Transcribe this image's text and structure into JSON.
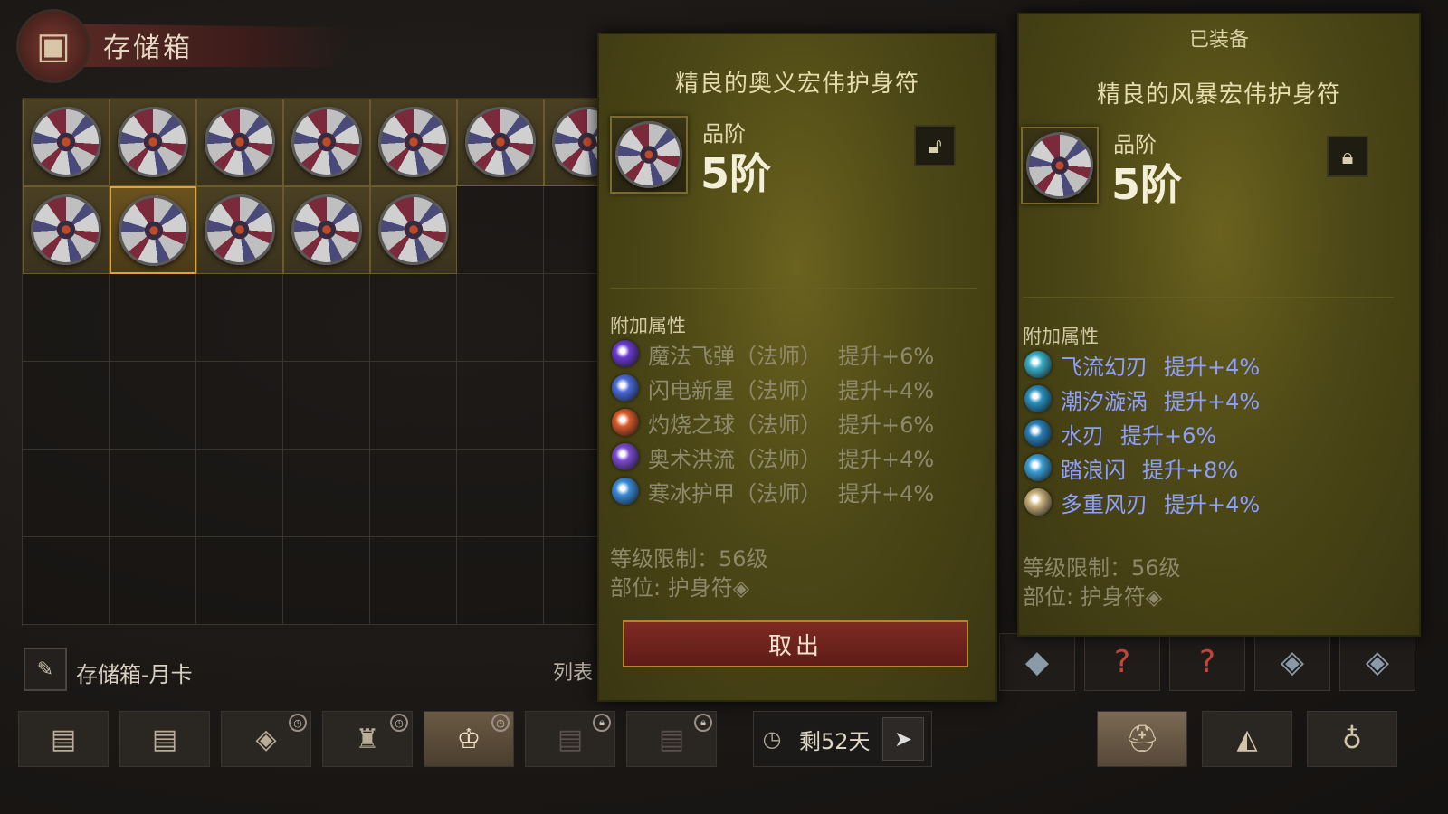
{
  "header": {
    "title": "存储箱",
    "icon": "chest-icon"
  },
  "grid": {
    "rows": 6,
    "cols": 7,
    "filled_slots": 13,
    "selected_slot": 9
  },
  "storage_footer": {
    "name": "存储箱-月卡",
    "list_label": "列表",
    "icon": "feather-icon"
  },
  "item_panel": {
    "title": "精良的奥义宏伟护身符",
    "tier_label": "品阶",
    "tier_value": "5阶",
    "lock_icon": "unlock-icon",
    "attr_heading": "附加属性",
    "attributes": [
      {
        "name": "魔法飞弹（法师）",
        "bonus": "提升+6%",
        "icon": "magic-missile-icon",
        "color": "#6a3acf"
      },
      {
        "name": "闪电新星（法师）",
        "bonus": "提升+4%",
        "icon": "lightning-nova-icon",
        "color": "#4a6ad8"
      },
      {
        "name": "灼烧之球（法师）",
        "bonus": "提升+6%",
        "icon": "fireball-icon",
        "color": "#d85a2a"
      },
      {
        "name": "奥术洪流（法师）",
        "bonus": "提升+4%",
        "icon": "arcane-torrent-icon",
        "color": "#7a4ad0"
      },
      {
        "name": "寒冰护甲（法师）",
        "bonus": "提升+4%",
        "icon": "ice-armor-icon",
        "color": "#3a8ad8"
      }
    ],
    "level_req": "等级限制：56级",
    "slot": "部位: 护身符◈",
    "take_out_label": "取出"
  },
  "equipped_panel": {
    "equipped_label": "已装备",
    "title": "精良的风暴宏伟护身符",
    "tier_label": "品阶",
    "tier_value": "5阶",
    "lock_icon": "lock-icon",
    "attr_heading": "附加属性",
    "attributes": [
      {
        "name": "飞流幻刃",
        "bonus": "提升+4%",
        "icon": "flowing-blade-icon",
        "color": "#3ab0c8"
      },
      {
        "name": "潮汐漩涡",
        "bonus": "提升+4%",
        "icon": "tidal-vortex-icon",
        "color": "#2a90c0"
      },
      {
        "name": "水刃",
        "bonus": "提升+6%",
        "icon": "water-blade-icon",
        "color": "#2a80b8"
      },
      {
        "name": "踏浪闪",
        "bonus": "提升+8%",
        "icon": "wave-dash-icon",
        "color": "#3aa0d8"
      },
      {
        "name": "多重风刃",
        "bonus": "提升+4%",
        "icon": "multi-wind-blade-icon",
        "color": "#c8b07a"
      }
    ],
    "level_req": "等级限制：56级",
    "slot": "部位: 护身符◈"
  },
  "equip_strip": [
    {
      "icon": "gem-socket-icon",
      "glyph": "◆"
    },
    {
      "icon": "unknown-slot-icon",
      "glyph": "?"
    },
    {
      "icon": "unknown-slot-icon",
      "glyph": "?"
    },
    {
      "icon": "amulet-eye-icon",
      "glyph": "◈"
    },
    {
      "icon": "amulet-eye-icon",
      "glyph": "◈"
    }
  ],
  "tabs": [
    {
      "icon": "chest-tab-icon",
      "glyph": "▤",
      "state": "normal"
    },
    {
      "icon": "chest-tab-icon",
      "glyph": "▤",
      "state": "normal"
    },
    {
      "icon": "gem-tab-icon",
      "glyph": "◈",
      "state": "timed"
    },
    {
      "icon": "armor-tab-icon",
      "glyph": "♜",
      "state": "timed"
    },
    {
      "icon": "crown-chest-tab-icon",
      "glyph": "♔",
      "state": "active-timed"
    },
    {
      "icon": "chest-tab-icon",
      "glyph": "▤",
      "state": "locked"
    },
    {
      "icon": "chest-tab-icon",
      "glyph": "▤",
      "state": "locked"
    }
  ],
  "timer": {
    "days_left": "剩52天",
    "clock_icon": "clock-icon",
    "send_icon": "send-icon"
  },
  "right_tabs": [
    {
      "icon": "helmet-icon",
      "glyph": "⛑",
      "state": "active"
    },
    {
      "icon": "material-icon",
      "glyph": "◭",
      "state": "normal"
    },
    {
      "icon": "money-bag-icon",
      "glyph": "♁",
      "state": "normal"
    }
  ]
}
